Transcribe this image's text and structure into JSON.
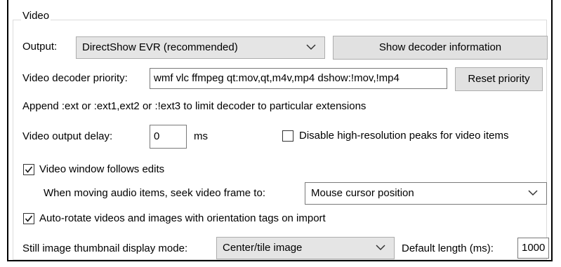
{
  "group": {
    "title": "Video"
  },
  "output": {
    "label": "Output:",
    "value": "DirectShow EVR (recommended)",
    "show_decoder_button": "Show decoder information"
  },
  "decoder_priority": {
    "label": "Video decoder priority:",
    "value": "wmf vlc ffmpeg qt:mov,qt,m4v,mp4 dshow:!mov,!mp4",
    "reset_button": "Reset priority",
    "hint": "Append :ext or :ext1,ext2 or :!ext3 to limit decoder to particular extensions"
  },
  "output_delay": {
    "label": "Video output delay:",
    "value": "0",
    "unit": "ms"
  },
  "disable_peaks": {
    "label": "Disable high-resolution peaks for video items",
    "checked": false
  },
  "follows_edits": {
    "label": "Video window follows edits",
    "checked": true
  },
  "seek": {
    "label": "When moving audio items, seek video frame to:",
    "value": "Mouse cursor position"
  },
  "auto_rotate": {
    "label": "Auto-rotate videos and images with orientation tags on import",
    "checked": true
  },
  "thumbnail": {
    "label": "Still image thumbnail display mode:",
    "value": "Center/tile image",
    "default_length_label": "Default length (ms):",
    "default_length_value": "1000"
  },
  "icons": [
    "chevron-down-icon",
    "checkmark-icon"
  ]
}
